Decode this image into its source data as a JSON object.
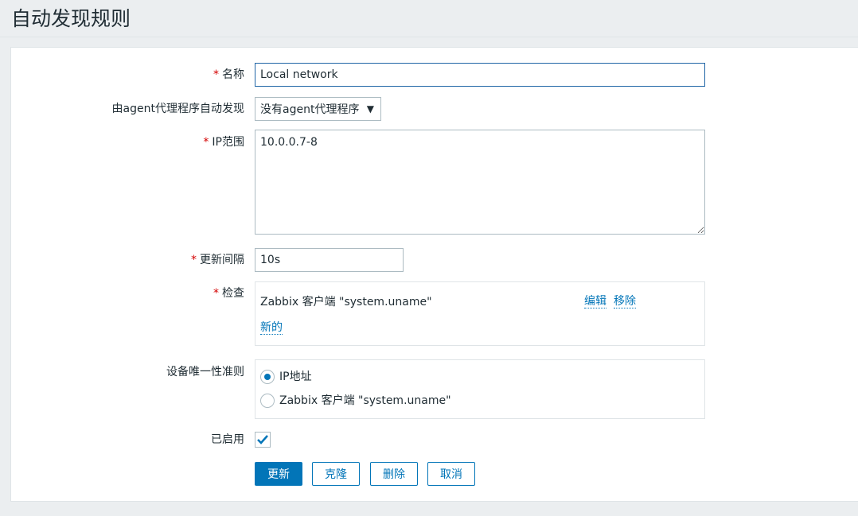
{
  "page": {
    "title": "自动发现规则"
  },
  "form": {
    "required_mark": "*",
    "name": {
      "label": "名称",
      "value": "Local network"
    },
    "proxy": {
      "label": "由agent代理程序自动发现",
      "selected": "没有agent代理程序",
      "arrow": "▼"
    },
    "ip_range": {
      "label": "IP范围",
      "value": "10.0.0.7-8"
    },
    "update_interval": {
      "label": "更新间隔",
      "value": "10s"
    },
    "checks": {
      "label": "检查",
      "items": [
        {
          "text": "Zabbix 客户端 \"system.uname\"",
          "edit": "编辑",
          "remove": "移除"
        }
      ],
      "new_link": "新的"
    },
    "uniqueness": {
      "label": "设备唯一性准则",
      "options": [
        {
          "text": "IP地址",
          "checked": true
        },
        {
          "text": "Zabbix 客户端 \"system.uname\"",
          "checked": false
        }
      ]
    },
    "enabled": {
      "label": "已启用",
      "checked": true
    },
    "buttons": {
      "update": "更新",
      "clone": "克隆",
      "delete": "删除",
      "cancel": "取消"
    }
  },
  "colors": {
    "accent": "#0275b8",
    "required": "#d40000",
    "background": "#ebeef0"
  }
}
